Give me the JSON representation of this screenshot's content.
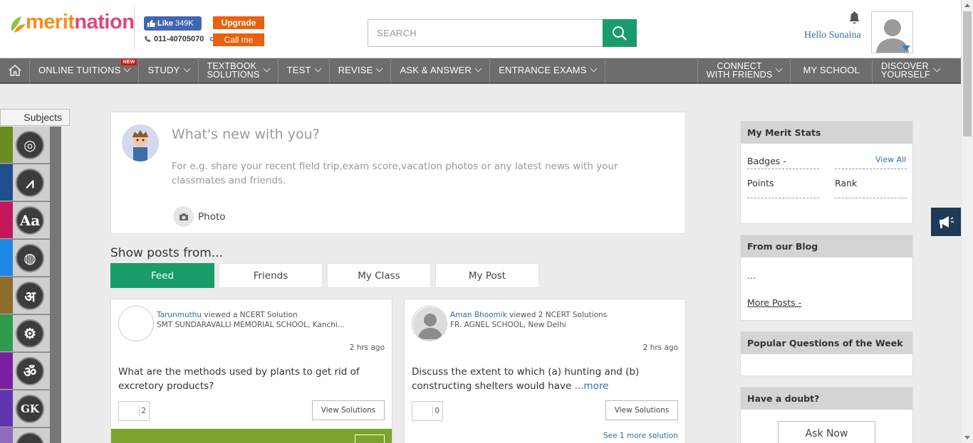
{
  "header": {
    "logo_merit": "merit",
    "logo_nation": "nation",
    "fb_like_label": "Like",
    "fb_like_count": "349K",
    "phone": "011-40705070",
    "or_label": "or",
    "upgrade_label": "Upgrade",
    "callme_label": "Call me",
    "search_placeholder": "SEARCH",
    "greeting": "Hello Sunaina"
  },
  "nav": {
    "new_badge": "NEW",
    "items": [
      {
        "label": "ONLINE TUITIONS"
      },
      {
        "label": "STUDY"
      },
      {
        "label_line1": "TEXTBOOK",
        "label_line2": "SOLUTIONS"
      },
      {
        "label": "TEST"
      },
      {
        "label": "REVISE"
      },
      {
        "label": "ASK & ANSWER"
      },
      {
        "label": "ENTRANCE EXAMS"
      },
      {
        "label_line1": "CONNECT",
        "label_line2": "WITH FRIENDS"
      },
      {
        "label": "MY SCHOOL"
      },
      {
        "label_line1": "DISCOVER",
        "label_line2": "YOURSELF"
      }
    ]
  },
  "sidebar": {
    "subjects_label": "Subjects",
    "subjects": [
      {
        "icon": "biology-icon",
        "glyph": "◎",
        "color": "#6b8e23"
      },
      {
        "icon": "compass-icon",
        "glyph": "⩘",
        "color": "#1f4e8c"
      },
      {
        "icon": "english-icon",
        "glyph": "Aa",
        "color": "#c2185b"
      },
      {
        "icon": "globe-icon",
        "glyph": "◍",
        "color": "#1e88e5"
      },
      {
        "icon": "hindi-icon",
        "glyph": "अ",
        "color": "#8d6e2c"
      },
      {
        "icon": "gear-icon",
        "glyph": "⚙",
        "color": "#2e9b4f"
      },
      {
        "icon": "sanskrit-icon",
        "glyph": "ॐ",
        "color": "#7b1fa2"
      },
      {
        "icon": "gk-icon",
        "glyph": "GK",
        "color": "#5e35b1"
      },
      {
        "icon": "more-subject-icon",
        "glyph": "∞",
        "color": "#8e6bbf"
      }
    ]
  },
  "composer": {
    "prompt": "What's new with you?",
    "hint": "For e.g. share your recent field trip,exam score,vacation photos or any latest news with your classmates and friends.",
    "photo_label": "Photo"
  },
  "feed": {
    "show_posts_label": "Show posts from...",
    "tabs": [
      "Feed",
      "Friends",
      "My Class",
      "My Post"
    ],
    "cards": [
      {
        "user": "Tarunmuthu",
        "action": "viewed a NCERT Solution",
        "school": "SMT SUNDARAVALLI MEMORIAL SCHOOL, Kanchi...",
        "time": "2 hrs ago",
        "question": "What are the methods used by plants to get rid of excretory products?",
        "more": "",
        "count": "2",
        "view_label": "View Solutions",
        "extra": ""
      },
      {
        "user": "Aman Bhoomik",
        "action": "viewed 2 NCERT Solutions",
        "school": "FR. AGNEL SCHOOL, New Delhi",
        "time": "2 hrs ago",
        "question": "Discuss the extent to which (a) hunting and (b) constructing shelters would have ",
        "more": "...more",
        "count": "0",
        "view_label": "View Solutions",
        "extra": "See 1 more solution"
      }
    ]
  },
  "right": {
    "merit_stats": {
      "title": "My Merit Stats",
      "badges_label": "Badges -",
      "view_all": "View All",
      "points_label": "Points",
      "rank_label": "Rank"
    },
    "blog": {
      "title": "From our Blog",
      "snippet": "...",
      "more_posts": "More Posts -"
    },
    "popular": {
      "title": "Popular Questions of the Week"
    },
    "doubt": {
      "title": "Have a doubt?",
      "ask_label": "Ask Now"
    }
  },
  "colors": {
    "accent_green": "#1a9b6a",
    "nav_gray": "#6d6d6d",
    "orange": "#e8610e",
    "link_blue": "#2c6fb0"
  }
}
